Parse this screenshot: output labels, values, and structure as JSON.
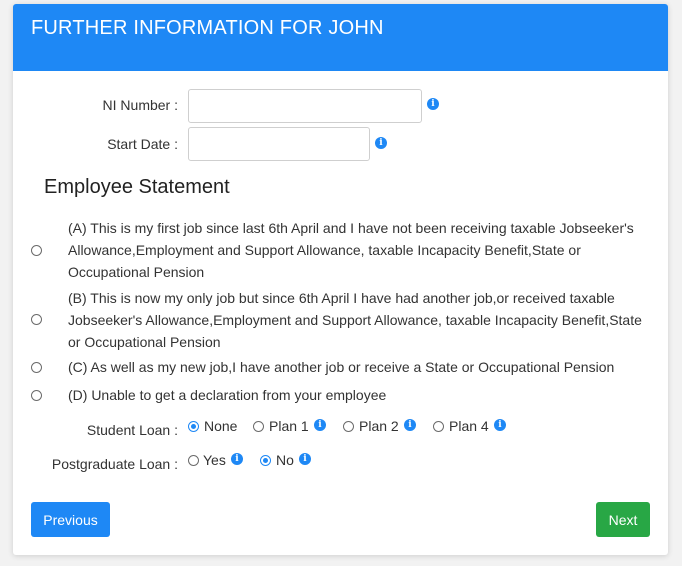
{
  "header": {
    "title": "FURTHER INFORMATION FOR JOHN"
  },
  "form": {
    "ni_number": {
      "label": "NI Number :",
      "value": "",
      "placeholder": ""
    },
    "start_date": {
      "label": "Start Date :",
      "value": "",
      "placeholder": ""
    }
  },
  "statement": {
    "title": "Employee Statement",
    "options": [
      {
        "letter": "A",
        "text": "(A) This is my first job since last 6th April and I have not been receiving taxable Jobseeker's Allowance,Employment and Support Allowance, taxable Incapacity Benefit,State or Occupational Pension",
        "selected": false
      },
      {
        "letter": "B",
        "text": "(B) This is now my only job but since 6th April I have had another job,or received taxable Jobseeker's Allowance,Employment and Support Allowance, taxable Incapacity Benefit,State or Occupational Pension",
        "selected": false
      },
      {
        "letter": "C",
        "text": "(C) As well as my new job,I have another job or receive a State or Occupational Pension",
        "selected": false
      },
      {
        "letter": "D",
        "text": "(D) Unable to get a declaration from your employee",
        "selected": false
      }
    ]
  },
  "student_loan": {
    "label": "Student Loan :",
    "options": [
      {
        "label": "None",
        "selected": true,
        "info": false
      },
      {
        "label": "Plan 1",
        "selected": false,
        "info": true
      },
      {
        "label": "Plan 2",
        "selected": false,
        "info": true
      },
      {
        "label": "Plan 4",
        "selected": false,
        "info": true
      }
    ]
  },
  "postgraduate_loan": {
    "label": "Postgraduate Loan :",
    "options": [
      {
        "label": "Yes",
        "selected": false,
        "info": true
      },
      {
        "label": "No",
        "selected": true,
        "info": true
      }
    ]
  },
  "buttons": {
    "previous": "Previous",
    "next": "Next"
  },
  "colors": {
    "primary": "#1e88f5",
    "success": "#28a745",
    "info_icon": "#1e88f5"
  },
  "icons": {
    "info": "info-icon"
  }
}
